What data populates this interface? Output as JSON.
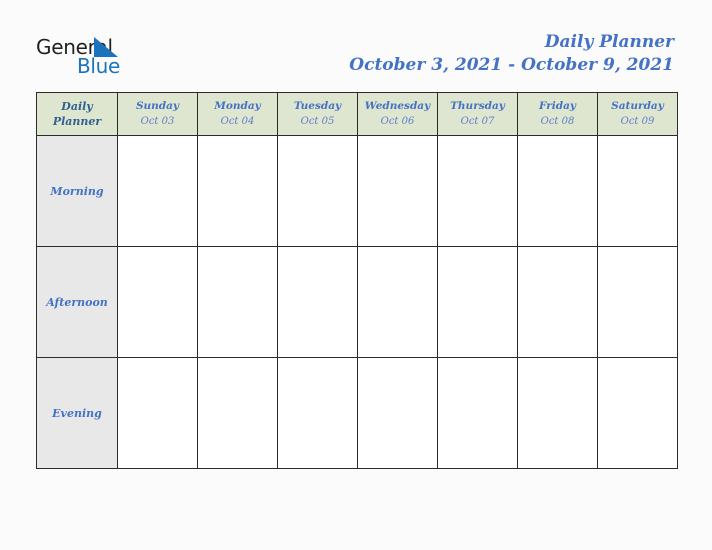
{
  "logo": {
    "word_top": "General",
    "word_bottom": "Blue",
    "triangle_color": "#1b74bb",
    "top_color": "#231f20",
    "bottom_color": "#1b74bb"
  },
  "header": {
    "title": "Daily Planner",
    "date_range": "October 3, 2021 - October 9, 2021",
    "accent_color": "#4472c4"
  },
  "calendar": {
    "corner": {
      "line1": "Daily",
      "line2": "Planner"
    },
    "header_bg": "#dfe6d0",
    "label_bg": "#e8e8e8",
    "border_color": "#2b2b2b",
    "days": [
      {
        "name": "Sunday",
        "date": "Oct 03"
      },
      {
        "name": "Monday",
        "date": "Oct 04"
      },
      {
        "name": "Tuesday",
        "date": "Oct 05"
      },
      {
        "name": "Wednesday",
        "date": "Oct 06"
      },
      {
        "name": "Thursday",
        "date": "Oct 07"
      },
      {
        "name": "Friday",
        "date": "Oct 08"
      },
      {
        "name": "Saturday",
        "date": "Oct 09"
      }
    ],
    "rows": [
      {
        "label": "Morning",
        "cells": [
          "",
          "",
          "",
          "",
          "",
          "",
          ""
        ]
      },
      {
        "label": "Afternoon",
        "cells": [
          "",
          "",
          "",
          "",
          "",
          "",
          ""
        ]
      },
      {
        "label": "Evening",
        "cells": [
          "",
          "",
          "",
          "",
          "",
          "",
          ""
        ]
      }
    ]
  }
}
